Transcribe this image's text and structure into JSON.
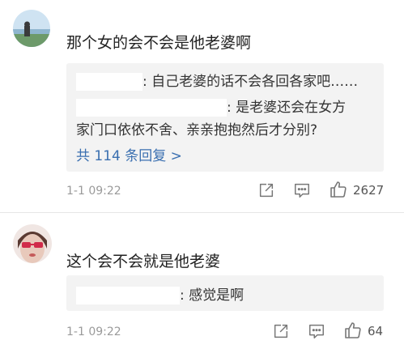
{
  "comments": [
    {
      "text": "那个女的会不会是他老婆啊",
      "replies": [
        ": 自己老婆的话不会各回各家吧……",
        ": 是老婆还会在女方",
        "家门口依依不舍、亲亲抱抱然后才分别?"
      ],
      "more_replies": "共 114 条回复 >",
      "time": "1-1 09:22",
      "likes": "2627"
    },
    {
      "text": "这个会不会就是他老婆",
      "replies": [
        ": 感觉是啊"
      ],
      "time": "1-1 09:22",
      "likes": "64"
    }
  ],
  "icons": {
    "share": "share-icon",
    "reply": "comment-icon",
    "like": "thumbs-up-icon"
  },
  "colors": {
    "link": "#3a6fb0",
    "reply_bg": "#f3f3f3",
    "meta": "#9a9a9a"
  }
}
